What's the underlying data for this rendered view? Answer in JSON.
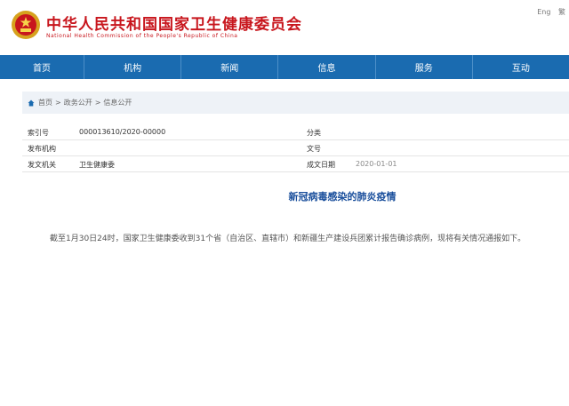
{
  "header": {
    "title": "中华人民共和国国家卫生健康委员会",
    "subtitle": "National Health Commission of the People's Republic of China",
    "top_links": [
      "Eng",
      "繁"
    ]
  },
  "nav": {
    "items": [
      "首页",
      "机构",
      "新闻",
      "信息",
      "服务",
      "互动"
    ]
  },
  "breadcrumb": {
    "items": [
      "首页",
      "政务公开",
      "信息公开"
    ]
  },
  "meta": {
    "row1": {
      "label": "索引号",
      "value": "000013610/2020-00000",
      "label2": "分类",
      "value2": ""
    },
    "row2": {
      "label": "发布机构",
      "value": "",
      "label2": "文号",
      "value2": ""
    },
    "row3": {
      "label": "发文机关",
      "value": "卫生健康委",
      "label2": "成文日期",
      "value2": "2020-01-01"
    }
  },
  "article": {
    "title": "新冠病毒感染的肺炎疫情",
    "body": "截至1月30日24时，国家卫生健康委收到31个省（自治区、直辖市）和新疆生产建设兵团累计报告确诊病例，现将有关情况通报如下。"
  },
  "colors": {
    "brand_red": "#c8161d",
    "nav_blue": "#1a6bb0",
    "title_blue": "#1a4f9c"
  }
}
